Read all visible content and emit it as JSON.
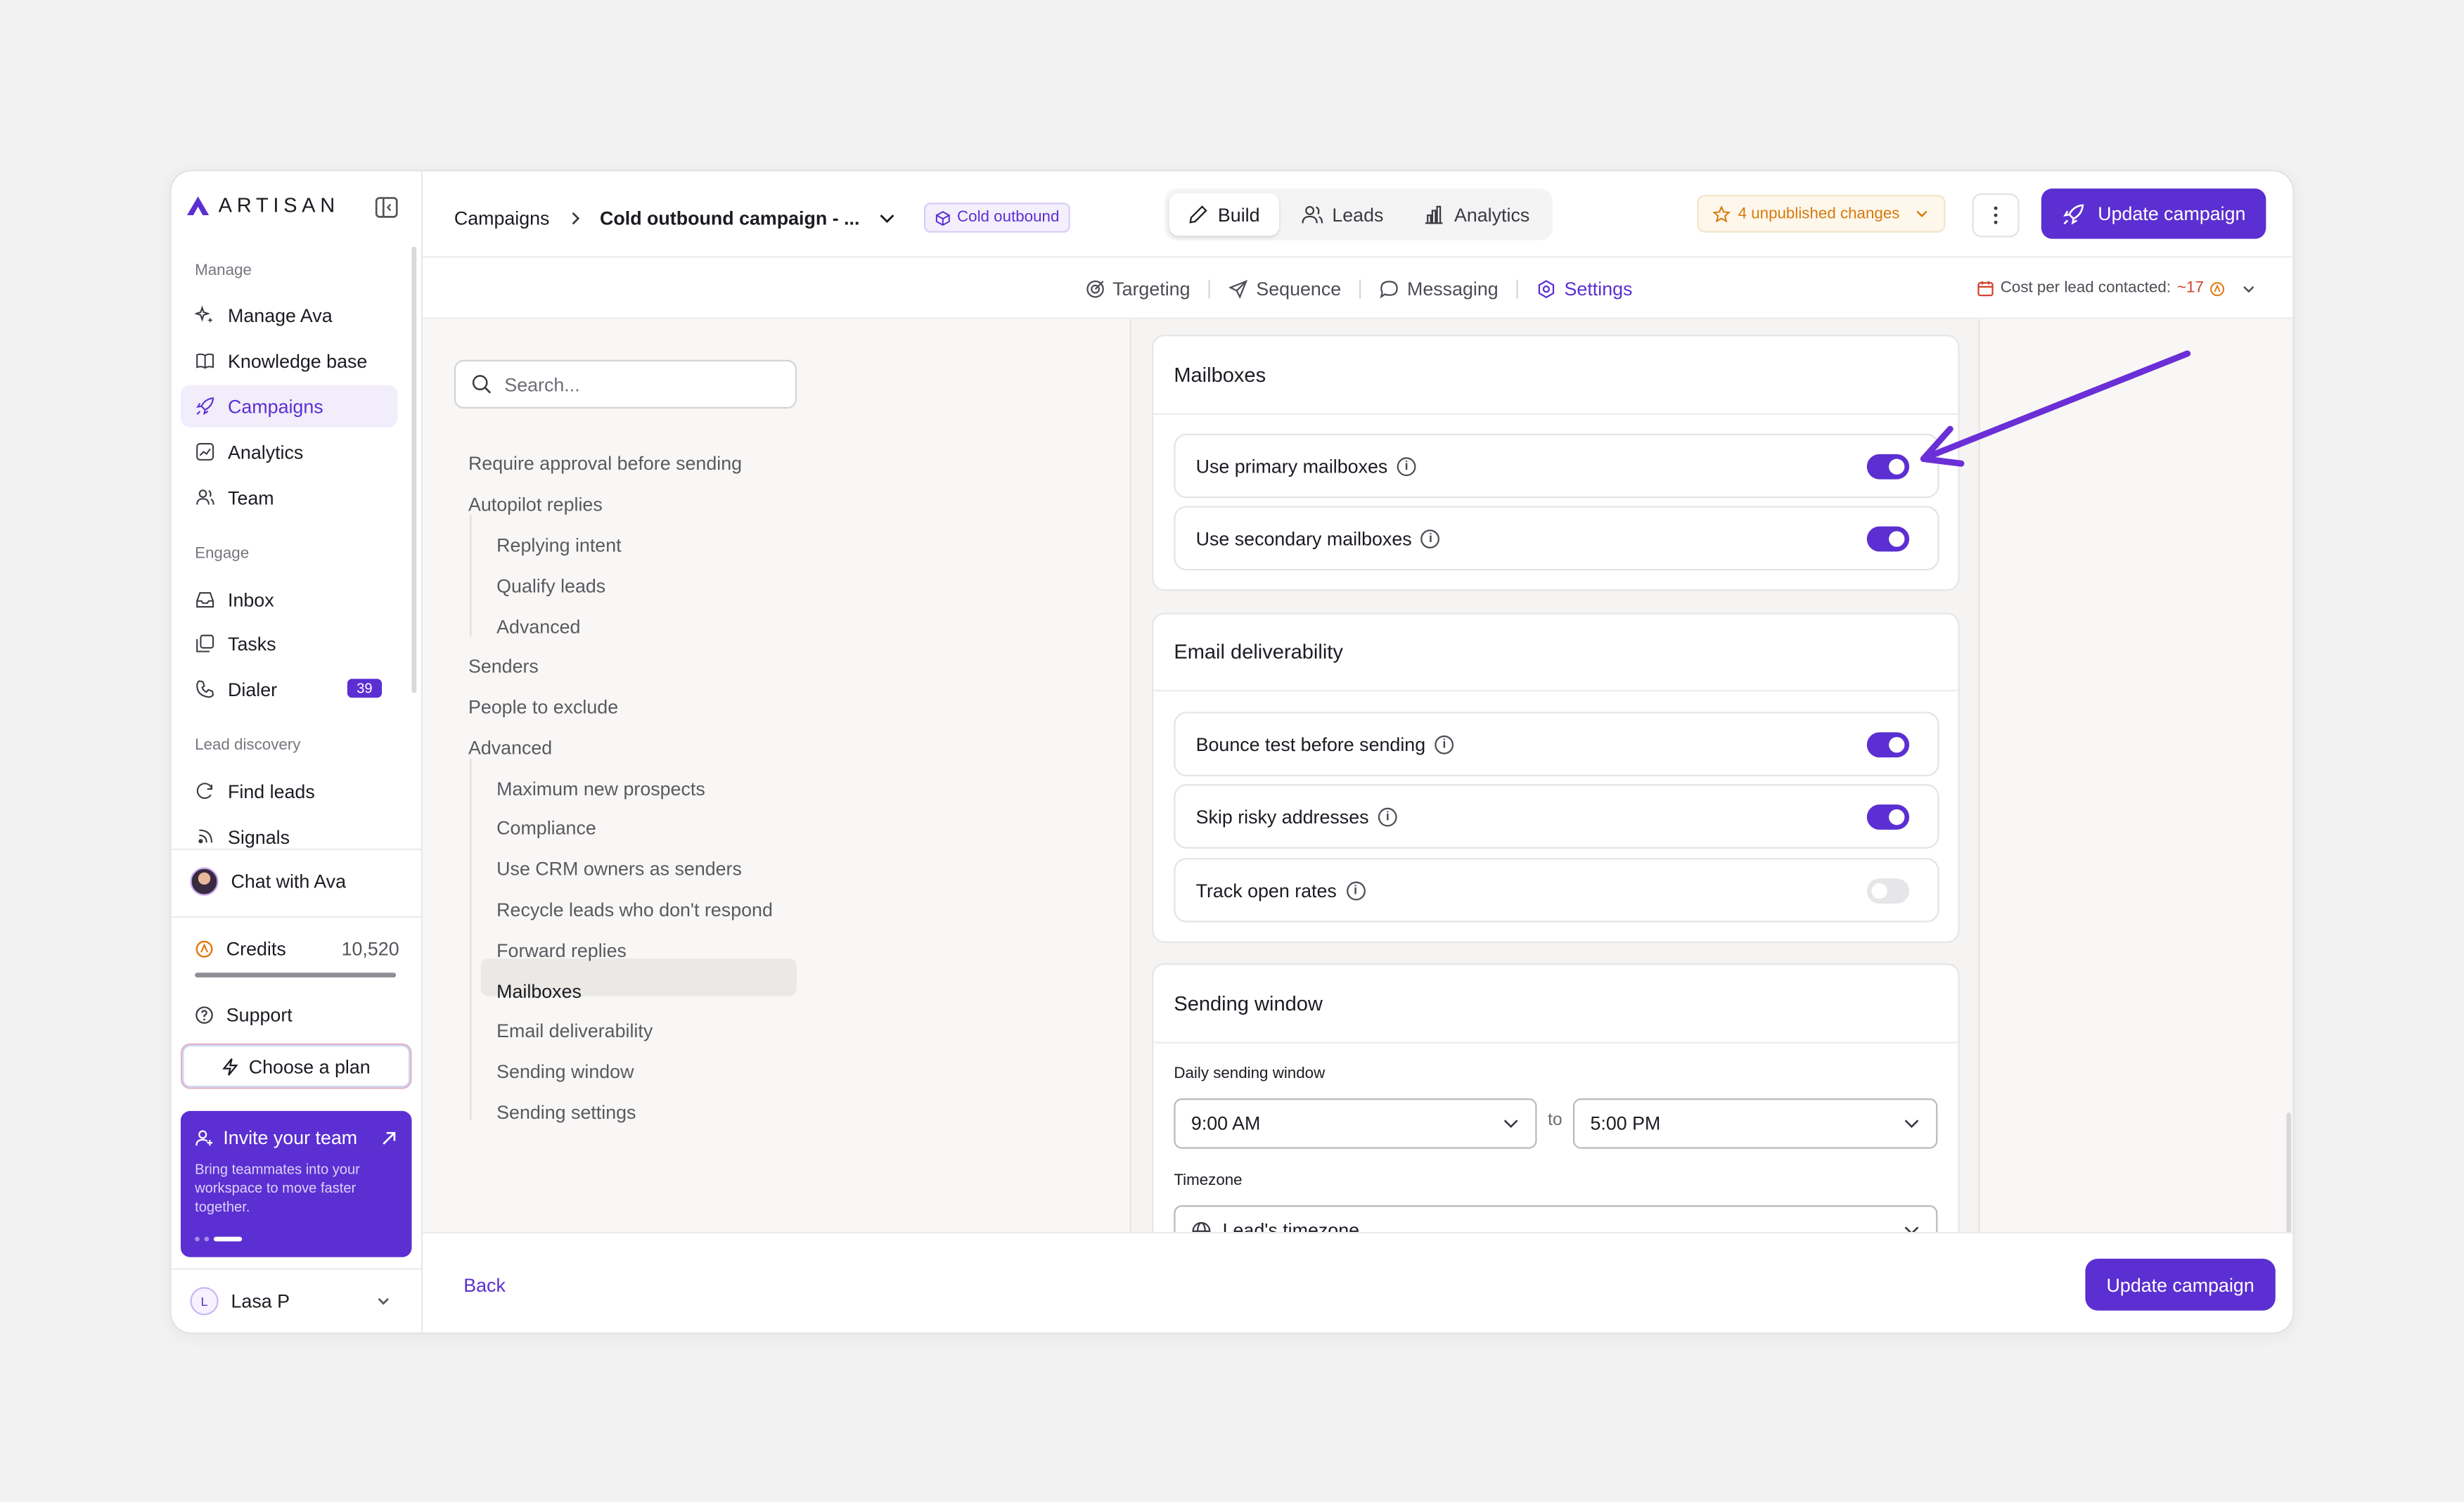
{
  "brand": {
    "name": "ARTISAN"
  },
  "sidebar": {
    "sections": {
      "manage": "Manage",
      "engage": "Engage",
      "lead_discovery": "Lead discovery"
    },
    "items": [
      {
        "label": "Manage Ava",
        "icon": "sparkle-icon"
      },
      {
        "label": "Knowledge base",
        "icon": "book-icon"
      },
      {
        "label": "Campaigns",
        "icon": "rocket-icon"
      },
      {
        "label": "Analytics",
        "icon": "chart-icon"
      },
      {
        "label": "Team",
        "icon": "users-icon"
      },
      {
        "label": "Inbox",
        "icon": "inbox-icon"
      },
      {
        "label": "Tasks",
        "icon": "tasks-icon"
      },
      {
        "label": "Dialer",
        "icon": "phone-icon",
        "badge": "39"
      },
      {
        "label": "Find leads",
        "icon": "find-icon"
      },
      {
        "label": "Signals",
        "icon": "signal-icon"
      }
    ],
    "chat": "Chat with Ava",
    "credits": {
      "label": "Credits",
      "value": "10,520"
    },
    "support": "Support",
    "plan_button": "Choose a plan",
    "invite": {
      "title": "Invite your team",
      "desc": "Bring teammates into your workspace to move faster together."
    },
    "user": {
      "initial": "L",
      "name": "Lasa P"
    }
  },
  "topbar": {
    "crumb_root": "Campaigns",
    "crumb_current": "Cold outbound campaign - ...",
    "tag": "Cold outbound",
    "tabs": [
      {
        "label": "Build"
      },
      {
        "label": "Leads"
      },
      {
        "label": "Analytics"
      }
    ],
    "unpublished": "4 unpublished changes",
    "update_button": "Update campaign"
  },
  "subnav": {
    "tabs": [
      {
        "label": "Targeting"
      },
      {
        "label": "Sequence"
      },
      {
        "label": "Messaging"
      },
      {
        "label": "Settings"
      }
    ],
    "cost_label": "Cost per lead contacted:",
    "cost_value": "~17"
  },
  "toc": {
    "search_placeholder": "Search...",
    "items": [
      "Require approval before sending",
      "Autopilot replies",
      "Replying intent",
      "Qualify leads",
      "Advanced",
      "Senders",
      "People to exclude",
      "Advanced",
      "Maximum new prospects",
      "Compliance",
      "Use CRM owners as senders",
      "Recycle leads who don't respond",
      "Forward replies",
      "Mailboxes",
      "Email deliverability",
      "Sending window",
      "Sending settings"
    ]
  },
  "mailboxes": {
    "title": "Mailboxes",
    "rows": [
      {
        "label": "Use primary mailboxes",
        "enabled": true
      },
      {
        "label": "Use secondary mailboxes",
        "enabled": true
      }
    ]
  },
  "deliverability": {
    "title": "Email deliverability",
    "rows": [
      {
        "label": "Bounce test before sending",
        "enabled": true
      },
      {
        "label": "Skip risky addresses",
        "enabled": true
      },
      {
        "label": "Track open rates",
        "enabled": false
      }
    ]
  },
  "sending_window": {
    "title": "Sending window",
    "daily_label": "Daily sending window",
    "start": "9:00 AM",
    "to": "to",
    "end": "5:00 PM",
    "timezone_label": "Timezone",
    "timezone": "Lead's timezone"
  },
  "footer": {
    "back": "Back",
    "update_button": "Update campaign"
  },
  "colors": {
    "accent": "#5b2fd1",
    "warning": "#d67a0c",
    "cost": "#d0422a"
  }
}
